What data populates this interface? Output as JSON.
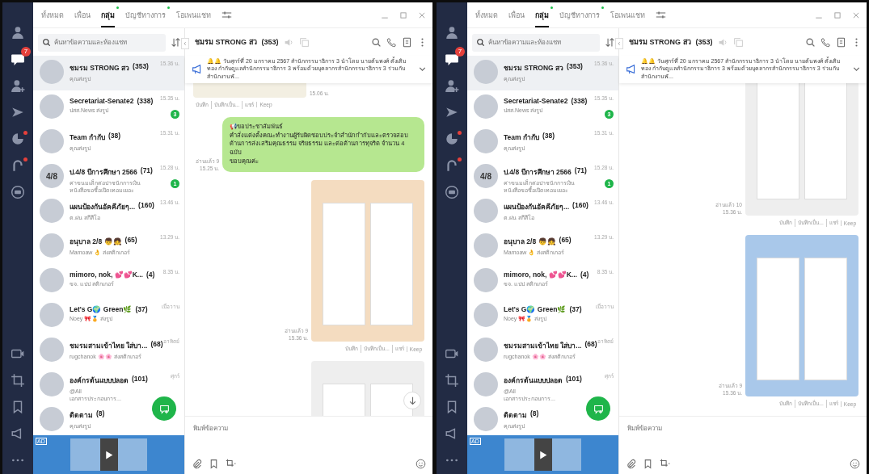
{
  "windows": [
    {
      "nav": [
        {
          "kind": "profile",
          "selected": false,
          "dot": false
        },
        {
          "kind": "chats",
          "selected": true,
          "dot": false,
          "badge": "7"
        },
        {
          "kind": "add-friend",
          "selected": false,
          "dot": false
        },
        {
          "kind": "voom",
          "selected": false,
          "dot": false
        },
        {
          "kind": "today",
          "selected": false,
          "dot": true
        },
        {
          "kind": "hook",
          "selected": false,
          "dot": true
        },
        {
          "kind": "line-app",
          "selected": false,
          "dot": false
        }
      ],
      "nav_bottom": [
        {
          "kind": "video"
        },
        {
          "kind": "crop"
        },
        {
          "kind": "bookmark"
        },
        {
          "kind": "announce"
        },
        {
          "kind": "more"
        }
      ],
      "tabs": [
        {
          "label": "ทั้งหมด",
          "selected": false,
          "dot": false
        },
        {
          "label": "เพื่อน",
          "selected": false,
          "dot": false
        },
        {
          "label": "กลุ่ม",
          "selected": true,
          "dot": true
        },
        {
          "label": "บัญชีทางการ",
          "selected": false,
          "dot": true
        },
        {
          "label": "โอเพนแชท",
          "selected": false,
          "dot": false
        }
      ],
      "search": {
        "placeholder": "ค้นหาข้อความและห้องแชท"
      },
      "chats": [
        {
          "name": "ชมรม STRONG สว",
          "count": "(353)",
          "preview": "คุณส่งรูป",
          "time": "15.36 น.",
          "selected": true
        },
        {
          "name": "Secretariat-Senate2",
          "count": "(338)",
          "preview": "ปสส.News ส่งรูป",
          "time": "15.35 น.",
          "selected": false,
          "badge": "3"
        },
        {
          "name": "Team กำกับ",
          "count": "(38)",
          "preview": "คุณส่งรูป",
          "time": "15.31 น.",
          "selected": false
        },
        {
          "name": "ป.4/8 ปีการศึกษา 2566",
          "count": "(71)",
          "preview": "ค่าขนมเด็กต่อปาชนักการเงิน หนังสือขอซื้อเปิดเทอมเยอะ",
          "time": "15.28 น.",
          "selected": false,
          "badge": "1",
          "avatar_text": "4/8"
        },
        {
          "name": "แผนป้องกันอัคคีภัยๆ...",
          "count": "(160)",
          "preview": "ต.ฝน สกีสีโอ",
          "time": "13.46 น.",
          "selected": false
        },
        {
          "name": "อนุบาล 2/8 👦👧",
          "count": "(65)",
          "preview": "Mamoaw 👌 ส่งสติกเกอร์",
          "time": "13.29 น.",
          "selected": false
        },
        {
          "name": "mimoro, nok, 💕💕K...",
          "count": "(4)",
          "preview": "ขจ. แปป สติกเกอร์",
          "time": "8.35 น.",
          "selected": false
        },
        {
          "name": "Let's G🌍 Green🌿",
          "count": "(37)",
          "preview": "Noey 🎀🏅 ส่งรูป",
          "time": "เมื่อวาน",
          "selected": false
        },
        {
          "name": "ชมรมสามเข้าไทย ใส่บา...",
          "count": "(68)",
          "preview": "rugchanok 🌸🌸 ส่งสติกเกอร์",
          "time": "อาทิตย์",
          "selected": false
        },
        {
          "name": "องค์กรต้นแบบปลอด",
          "count": "(101)",
          "preview": "@All\nเอกสารประกอบการ...",
          "time": "ศุกร์",
          "selected": false
        },
        {
          "name": "ติดตาม",
          "count": "(8)",
          "preview": "คุณส่งรูป",
          "selected": false
        }
      ],
      "ad": {
        "label": "AD"
      },
      "conversation": {
        "title": "ชมรม STRONG สว",
        "count": "(353)",
        "announcement": "🔔🔔 วันศุกร์ที่ 20 มกราคม 2567 สำนักกรรมาธิการ 3 นำโดย นายต้นพงศ์ ตั้งเติมทอง กำกับดูแลสำนักกรรมาธิการ 3 พร้อมด้วยบุคลากรสำนักกรรมาธิการ 3 ร่วมกับสำนักงานพั...",
        "scroll_down_button": true,
        "input_placeholder": "พิมพ์ข้อความ",
        "messages": [
          {
            "kind": "image",
            "sent": false,
            "color": "#f3efe2",
            "time": "15.06 น.",
            "actions": [
              "บันทึก",
              "บันทึกเป็น...",
              "แชร์",
              "Keep"
            ]
          },
          {
            "kind": "text",
            "sent": true,
            "text": "📢ขอประชาสัมพันธ์\nคำสั่งแต่งตั้งคณะทำงานผู้รับผิดชอบประจำสำนักกำกับและตรวจสอบ\nด้านการส่งเสริมคุณธรรม จริยธรรม และต่อต้านการทุจริต จำนวน 4 ฉบับ\nขอบคุณค่ะ",
            "read": "อ่านแล้ว 9",
            "time": "15.25 น."
          },
          {
            "kind": "image",
            "sent": true,
            "color": "#f4dcc0",
            "read": "อ่านแล้ว 9",
            "time": "15.36 น.",
            "actions": [
              "บันทึก",
              "บันทึกเป็น...",
              "แชร์",
              "Keep"
            ]
          },
          {
            "kind": "image",
            "sent": true,
            "color": "#eeeeee"
          }
        ]
      }
    },
    {
      "nav": [
        {
          "kind": "profile",
          "selected": false,
          "dot": false
        },
        {
          "kind": "chats",
          "selected": true,
          "dot": false,
          "badge": "7"
        },
        {
          "kind": "add-friend",
          "selected": false,
          "dot": false
        },
        {
          "kind": "voom",
          "selected": false,
          "dot": false
        },
        {
          "kind": "today",
          "selected": false,
          "dot": true
        },
        {
          "kind": "hook",
          "selected": false,
          "dot": true
        },
        {
          "kind": "line-app",
          "selected": false,
          "dot": false
        }
      ],
      "nav_bottom": [
        {
          "kind": "video"
        },
        {
          "kind": "crop"
        },
        {
          "kind": "bookmark"
        },
        {
          "kind": "announce"
        },
        {
          "kind": "more"
        }
      ],
      "tabs": [
        {
          "label": "ทั้งหมด",
          "selected": false,
          "dot": false
        },
        {
          "label": "เพื่อน",
          "selected": false,
          "dot": false
        },
        {
          "label": "กลุ่ม",
          "selected": true,
          "dot": true
        },
        {
          "label": "บัญชีทางการ",
          "selected": false,
          "dot": true
        },
        {
          "label": "โอเพนแชท",
          "selected": false,
          "dot": false
        }
      ],
      "search": {
        "placeholder": "ค้นหาข้อความและห้องแชท"
      },
      "chats": [
        {
          "name": "ชมรม STRONG สว",
          "count": "(353)",
          "preview": "คุณส่งรูป",
          "time": "15.36 น.",
          "selected": true
        },
        {
          "name": "Secretariat-Senate2",
          "count": "(338)",
          "preview": "ปสส.News ส่งรูป",
          "time": "15.35 น.",
          "selected": false,
          "badge": "3"
        },
        {
          "name": "Team กำกับ",
          "count": "(38)",
          "preview": "คุณส่งรูป",
          "time": "15.31 น.",
          "selected": false
        },
        {
          "name": "ป.4/8 ปีการศึกษา 2566",
          "count": "(71)",
          "preview": "ค่าขนมเด็กต่อปาชนักการเงิน หนังสือขอซื้อเปิดเทอมเยอะ",
          "time": "15.28 น.",
          "selected": false,
          "badge": "1",
          "avatar_text": "4/8"
        },
        {
          "name": "แผนป้องกันอัคคีภัยๆ...",
          "count": "(160)",
          "preview": "ต.ฝน สกีสีโอ",
          "time": "13.46 น.",
          "selected": false
        },
        {
          "name": "อนุบาล 2/8 👦👧",
          "count": "(65)",
          "preview": "Mamoaw 👌 ส่งสติกเกอร์",
          "time": "13.29 น.",
          "selected": false
        },
        {
          "name": "mimoro, nok, 💕💕K...",
          "count": "(4)",
          "preview": "ขจ. แปป สติกเกอร์",
          "time": "8.35 น.",
          "selected": false
        },
        {
          "name": "Let's G🌍 Green🌿",
          "count": "(37)",
          "preview": "Noey 🎀🏅 ส่งรูป",
          "time": "เมื่อวาน",
          "selected": false
        },
        {
          "name": "ชมรมสามเข้าไทย ใส่บา...",
          "count": "(68)",
          "preview": "rugchanok 🌸🌸 ส่งสติกเกอร์",
          "time": "อาทิตย์",
          "selected": false
        },
        {
          "name": "องค์กรต้นแบบปลอด",
          "count": "(101)",
          "preview": "@All\nเอกสารประกอบการ...",
          "time": "ศุกร์",
          "selected": false
        },
        {
          "name": "ติดตาม",
          "count": "(8)",
          "preview": "คุณส่งรูป",
          "selected": false
        }
      ],
      "ad": {
        "label": "AD"
      },
      "conversation": {
        "title": "ชมรม STRONG สว",
        "count": "(353)",
        "announcement": "🔔🔔 วันศุกร์ที่ 20 มกราคม 2567 สำนักกรรมาธิการ 3 นำโดย นายต้นพงศ์ ตั้งเติมทอง กำกับดูแลสำนักกรรมาธิการ 3 พร้อมด้วยบุคลากรสำนักกรรมาธิการ 3 ร่วมกับสำนักงานพั...",
        "scroll_down_button": false,
        "input_placeholder": "พิมพ์ข้อความ",
        "messages": [
          {
            "kind": "image",
            "sent": true,
            "color": "#eeeeee",
            "read": "อ่านแล้ว 10",
            "time": "15.36 น.",
            "actions": [
              "บันทึก",
              "บันทึกเป็น...",
              "แชร์",
              "Keep"
            ]
          },
          {
            "kind": "image",
            "sent": true,
            "color": "#a9c8ea",
            "read": "อ่านแล้ว 9",
            "time": "15.36 น.",
            "actions": [
              "บันทึก",
              "บันทึกเป็น...",
              "แชร์",
              "Keep"
            ]
          }
        ]
      }
    }
  ]
}
